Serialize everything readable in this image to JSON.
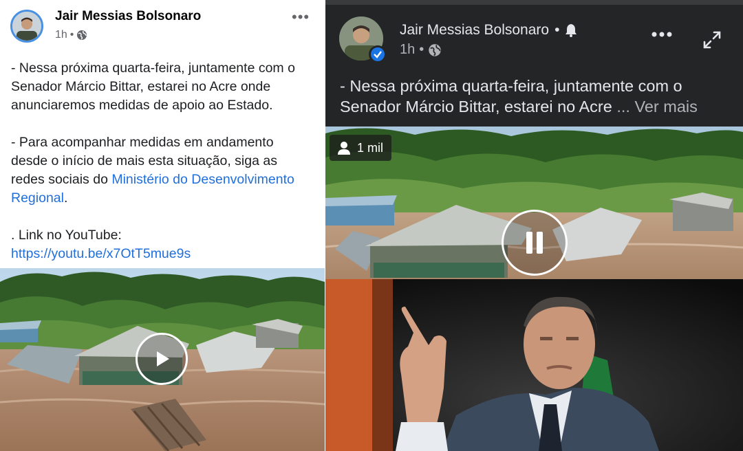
{
  "light_post": {
    "author": "Jair Messias Bolsonaro",
    "time": "1h",
    "separator": "•",
    "body": {
      "p1": "- Nessa próxima quarta-feira, juntamente com o Senador Márcio Bittar, estarei no Acre onde anunciaremos medidas de apoio ao Estado.",
      "p2_prefix": "- Para acompanhar medidas em andamento desde o início de mais esta situação, siga as redes sociais do ",
      "p2_link": "Ministério do Desenvolvimento Regional",
      "p2_suffix": ".",
      "p3": ". Link no YouTube:",
      "youtube_link": "https://youtu.be/x7OtT5mue9s"
    },
    "link_color": "#216fdb"
  },
  "dark_post": {
    "author": "Jair Messias Bolsonaro",
    "separator": "•",
    "time": "1h",
    "text_line1": "- Nessa próxima quarta-feira, juntamente com o",
    "text_line2": "Senador Márcio Bittar, estarei no Acre",
    "see_more": "... Ver mais",
    "views": "1 mil",
    "verified_color": "#1b74e4",
    "background": "#242526"
  },
  "icons": [
    "globe-icon",
    "more-options-icon",
    "bell-icon",
    "verified-badge-icon",
    "expand-icon",
    "person-icon",
    "play-icon",
    "pause-icon"
  ]
}
